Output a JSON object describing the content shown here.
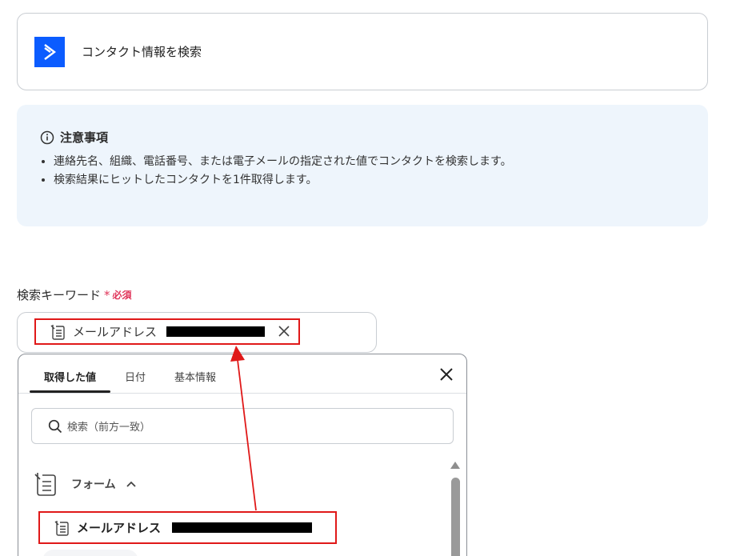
{
  "action": {
    "title": "コンタクト情報を検索",
    "icon": "activecampaign-chevron-icon",
    "brand_color": "#0b5cff"
  },
  "notice": {
    "icon": "info-circle-icon",
    "title": "注意事項",
    "items": [
      "連絡先名、組織、電話番号、または電子メールの指定された値でコンタクトを検索します。",
      "検索結果にヒットしたコンタクトを1件取得します。"
    ]
  },
  "field": {
    "label": "検索キーワード",
    "required_mark": "*",
    "required_text": "必須",
    "chip": {
      "label": "メールアドレス",
      "icon": "form-icon",
      "close_icon": "close-icon"
    }
  },
  "popup": {
    "tabs": [
      {
        "label": "取得した値",
        "active": true
      },
      {
        "label": "日付",
        "active": false
      },
      {
        "label": "基本情報",
        "active": false
      }
    ],
    "close_icon": "close-icon",
    "search": {
      "icon": "search-icon",
      "placeholder": "検索（前方一致）"
    },
    "group": {
      "label": "フォーム",
      "icon": "form-icon",
      "chevron": "chevron-up-icon",
      "items": [
        {
          "label": "メールアドレス",
          "icon": "form-icon"
        }
      ]
    }
  },
  "annotation_color": "#e01919"
}
